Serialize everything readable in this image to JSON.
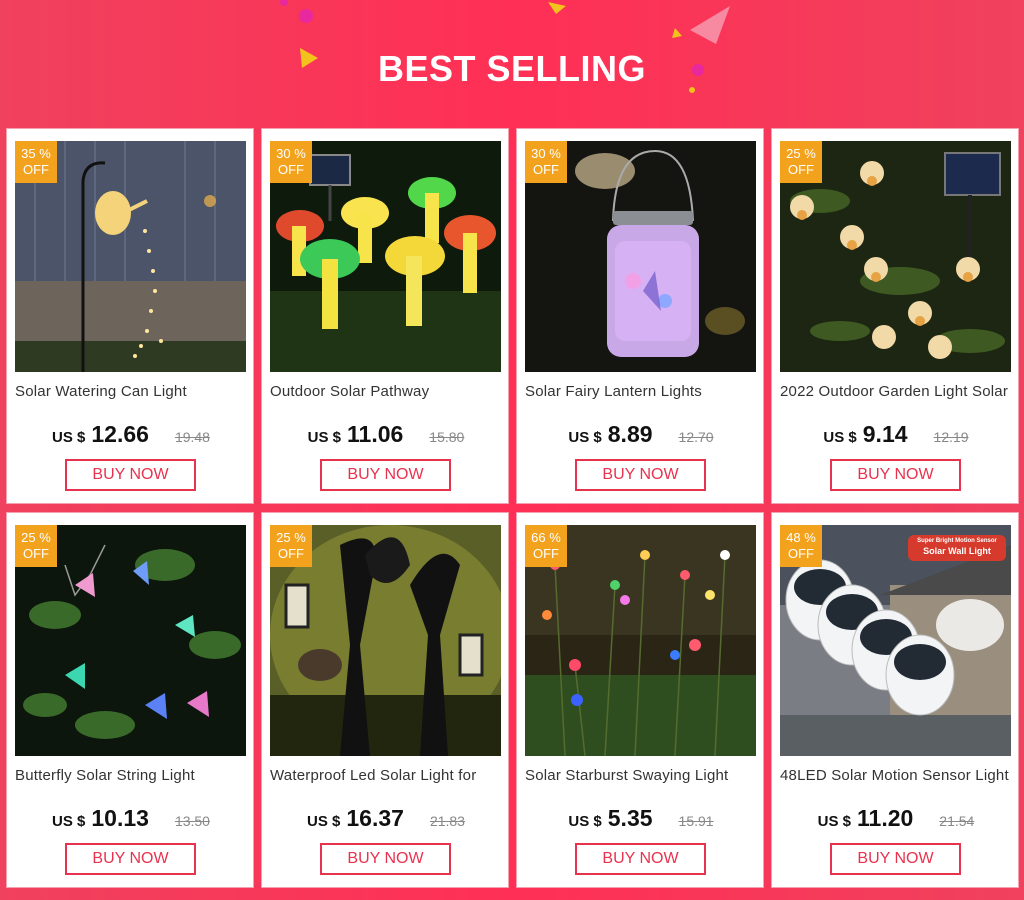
{
  "header": {
    "title": "BEST SELLING"
  },
  "colors": {
    "background": "#f5344f",
    "badge": "#f3a21d",
    "button": "#e8334f"
  },
  "products": [
    {
      "discount": "35 %",
      "off": "OFF",
      "name": "Solar Watering Can Light",
      "currency": "US $",
      "price": "12.66",
      "old_price": "19.48",
      "button": "BUY NOW"
    },
    {
      "discount": "30 %",
      "off": "OFF",
      "name": "Outdoor Solar Pathway",
      "currency": "US $",
      "price": "11.06",
      "old_price": "15.80",
      "button": "BUY NOW"
    },
    {
      "discount": "30 %",
      "off": "OFF",
      "name": "Solar Fairy Lantern Lights",
      "currency": "US $",
      "price": "8.89",
      "old_price": "12.70",
      "button": "BUY NOW"
    },
    {
      "discount": "25 %",
      "off": "OFF",
      "name": "2022 Outdoor Garden Light Solar",
      "currency": "US $",
      "price": "9.14",
      "old_price": "12.19",
      "button": "BUY NOW"
    },
    {
      "discount": "25 %",
      "off": "OFF",
      "name": "Butterfly Solar String Light",
      "currency": "US $",
      "price": "10.13",
      "old_price": "13.50",
      "button": "BUY NOW"
    },
    {
      "discount": "25 %",
      "off": "OFF",
      "name": "Waterproof Led Solar Light for",
      "currency": "US $",
      "price": "16.37",
      "old_price": "21.83",
      "button": "BUY NOW"
    },
    {
      "discount": "66 %",
      "off": "OFF",
      "name": "Solar Starburst Swaying Light",
      "currency": "US $",
      "price": "5.35",
      "old_price": "15.91",
      "button": "BUY NOW"
    },
    {
      "discount": "48 %",
      "off": "OFF",
      "name": "48LED Solar Motion Sensor Light",
      "currency": "US $",
      "price": "11.20",
      "old_price": "21.54",
      "button": "BUY NOW",
      "photo_text": [
        "Super Bright Motion Sensor",
        "Solar Wall Light"
      ]
    }
  ]
}
